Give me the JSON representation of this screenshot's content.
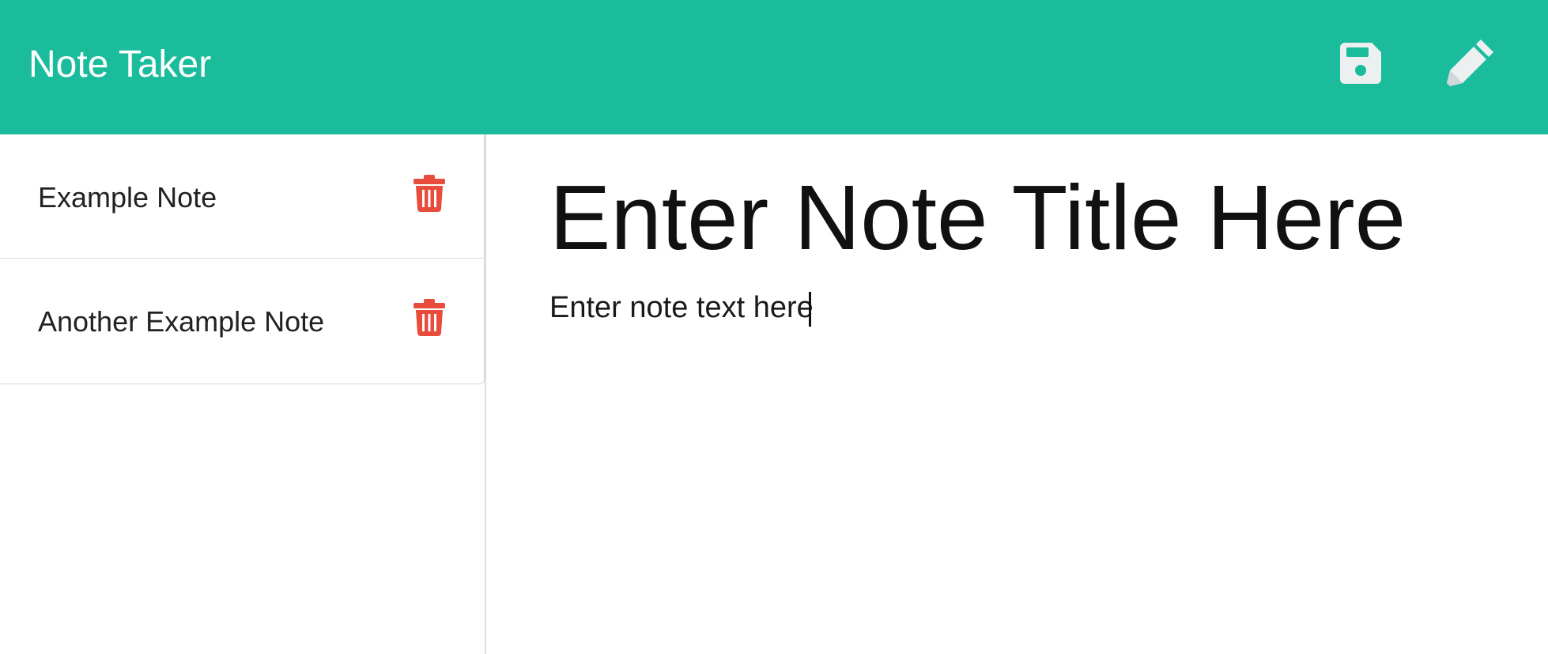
{
  "header": {
    "brand": "Note Taker",
    "save_icon": "save-icon",
    "edit_icon": "pencil-icon",
    "bg_color": "#1abc9c"
  },
  "notes": [
    {
      "title": "Example Note",
      "delete_icon": "trash-icon"
    },
    {
      "title": "Another Example Note",
      "delete_icon": "trash-icon"
    }
  ],
  "delete_color": "#e74c3c",
  "editor": {
    "title_placeholder": "Enter Note Title Here",
    "text_placeholder": "Enter note text here"
  }
}
